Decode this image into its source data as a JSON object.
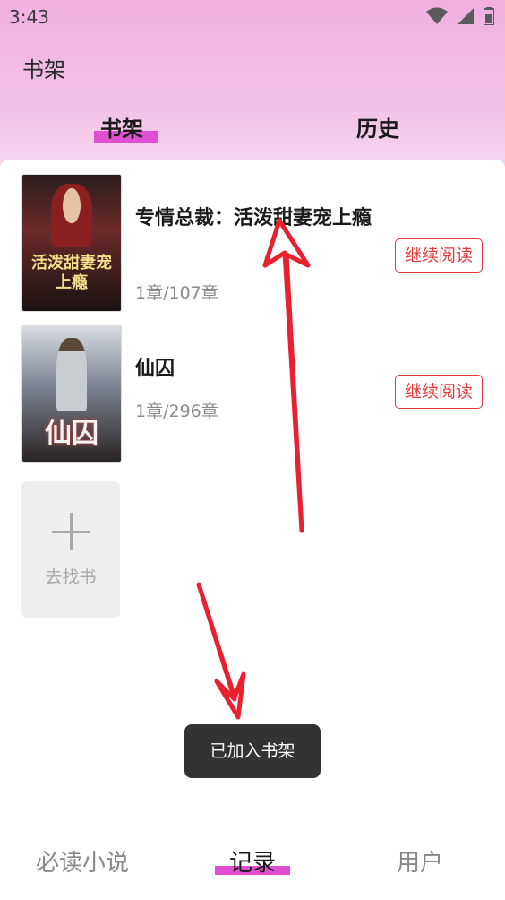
{
  "status_bar": {
    "time": "3:43",
    "icons": [
      "wifi-icon",
      "signal-icon",
      "battery-icon"
    ]
  },
  "app_title": "书架",
  "tabs": [
    {
      "label": "书架",
      "active": true
    },
    {
      "label": "历史",
      "active": false
    }
  ],
  "books": [
    {
      "title": "专情总裁：活泼甜妻宠上瘾",
      "progress": "1章/107章",
      "action": "继续阅读",
      "cover_text": "活泼甜妻宠上瘾"
    },
    {
      "title": "仙囚",
      "progress": "1章/296章",
      "action": "继续阅读",
      "cover_text": "仙囚"
    }
  ],
  "find_book": {
    "label": "去找书"
  },
  "toast": "已加入书架",
  "bottom_nav": [
    {
      "label": "必读小说",
      "active": false
    },
    {
      "label": "记录",
      "active": true
    },
    {
      "label": "用户",
      "active": false
    }
  ],
  "colors": {
    "accent": "#e04fd2",
    "action": "#e23b3b",
    "header_gradient_top": "#f0b0e0",
    "annotation_arrow": "#e8202f"
  }
}
